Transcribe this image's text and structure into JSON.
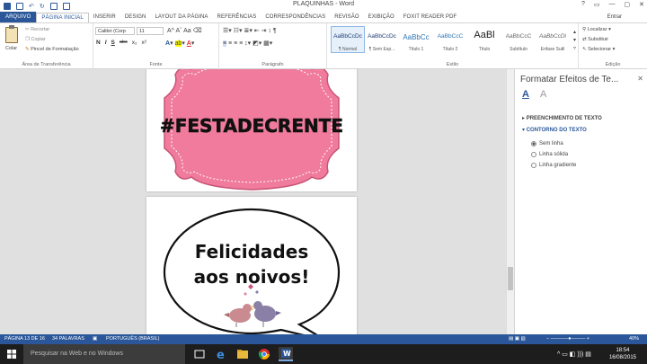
{
  "window": {
    "title": "PLAQUINHAS - Word",
    "controls": [
      "?",
      "▭",
      "—",
      "▢",
      "✕"
    ]
  },
  "tabs": [
    {
      "label": "ARQUIVO"
    },
    {
      "label": "PÁGINA INICIAL"
    },
    {
      "label": "INSERIR"
    },
    {
      "label": "DESIGN"
    },
    {
      "label": "LAYOUT DA PÁGINA"
    },
    {
      "label": "REFERÊNCIAS"
    },
    {
      "label": "CORRESPONDÊNCIAS"
    },
    {
      "label": "REVISÃO"
    },
    {
      "label": "EXIBIÇÃO"
    },
    {
      "label": "FOXIT READER PDF"
    }
  ],
  "signin": "Entrar",
  "ribbon": {
    "clipboard": {
      "paste": "Colar",
      "cut": "Recortar",
      "copy": "Copiar",
      "format_painter": "Pincel de Formatação",
      "label": "Área de Transferência"
    },
    "font": {
      "family": "Calibri (Corp",
      "size": "11",
      "row2": [
        "N",
        "I",
        "S",
        "abc",
        "x₂",
        "x²"
      ],
      "label": "Fonte"
    },
    "paragraph": {
      "label": "Parágrafo"
    },
    "styles": {
      "items": [
        {
          "sample": "AaBbCcDc",
          "name": "¶ Normal"
        },
        {
          "sample": "AaBbCcDc",
          "name": "¶ Sem Esp..."
        },
        {
          "sample": "AaBbCc",
          "name": "Título 1"
        },
        {
          "sample": "AaBbCcC",
          "name": "Título 2"
        },
        {
          "sample": "AaBl",
          "name": "Título"
        },
        {
          "sample": "AaBbCcC",
          "name": "Subtítulo"
        },
        {
          "sample": "AaBbCcDi",
          "name": "Ênfase Sutil"
        }
      ],
      "label": "Estilo"
    },
    "editing": {
      "find": "Localizar",
      "replace": "Substituir",
      "select": "Selecionar",
      "label": "Edição"
    }
  },
  "document": {
    "plaque1_text": "#FESTADECRENTE",
    "bubble_line1": "Felicidades",
    "bubble_line2": "aos noivos!",
    "colors": {
      "pink": "#f07b9c",
      "dark_pink": "#c95577",
      "bird1": "#c98b8f",
      "bird2": "#8a7fa6"
    }
  },
  "pane": {
    "title": "Formatar Efeitos de Te...",
    "close": "✕",
    "section1": "PREENCHIMENTO DE TEXTO",
    "section2": "CONTORNO DO TEXTO",
    "options": [
      "Sem linha",
      "Linha sólida",
      "Linha gradiente"
    ],
    "selected_option": "Sem linha"
  },
  "status": {
    "page": "PÁGINA 13 DE 16",
    "words": "34 PALAVRAS",
    "language": "PORTUGUÊS (BRASIL)",
    "zoom": "40%"
  },
  "taskbar": {
    "search_placeholder": "Pesquisar na Web e no Windows",
    "time": "18:54",
    "date": "16/08/2015"
  }
}
